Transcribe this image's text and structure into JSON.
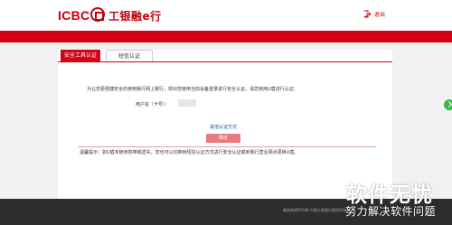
{
  "header": {
    "brand_en": "ICBC",
    "brand_cn": "工银融e行",
    "exit_label": "退出",
    "exit_icon": "exit-icon"
  },
  "tabs": [
    {
      "label": "安全工具认证",
      "active": true
    },
    {
      "label": "短信认证",
      "active": false
    }
  ],
  "main": {
    "intro": "为让您更便捷安全的使用我行网上银行，现对您使用当前设备登录进行安全认证。请您使用U盾进行认证：",
    "id_label": "用户名（卡号）：",
    "other_method_link": "其他认证方式",
    "confirm_button": "确定",
    "tip": "温馨提示：如U盾未随身携带或遗失，您也可以切换到短信认证方式进行安全认证或到我行营业网点更换U盾。"
  },
  "footer": {
    "text": "服务热线95588  中国工商银行版权所有"
  },
  "watermark": {
    "main": "软件无忧",
    "sub": "努力解决软件问题"
  },
  "colors": {
    "brand_red": "#d40015",
    "button_pink": "#e77a80",
    "link_blue": "#1a4fa3",
    "footer_dark": "#2d2d2d"
  }
}
